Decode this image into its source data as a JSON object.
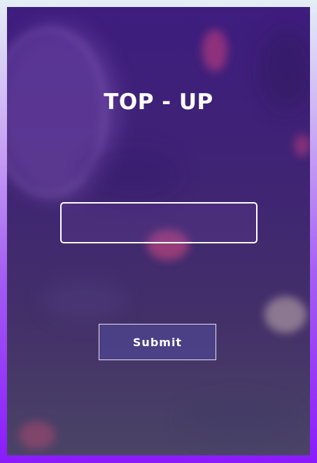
{
  "form": {
    "title": "TOP - UP",
    "amount_input": {
      "value": "",
      "placeholder": ""
    },
    "submit_label": "Submit"
  },
  "colors": {
    "page_gradient_top": "#e4eef6",
    "page_gradient_bottom": "#8a1bfb",
    "card_top": "#3e1d7e",
    "card_bottom": "#4a4466",
    "text": "#ffffff"
  }
}
